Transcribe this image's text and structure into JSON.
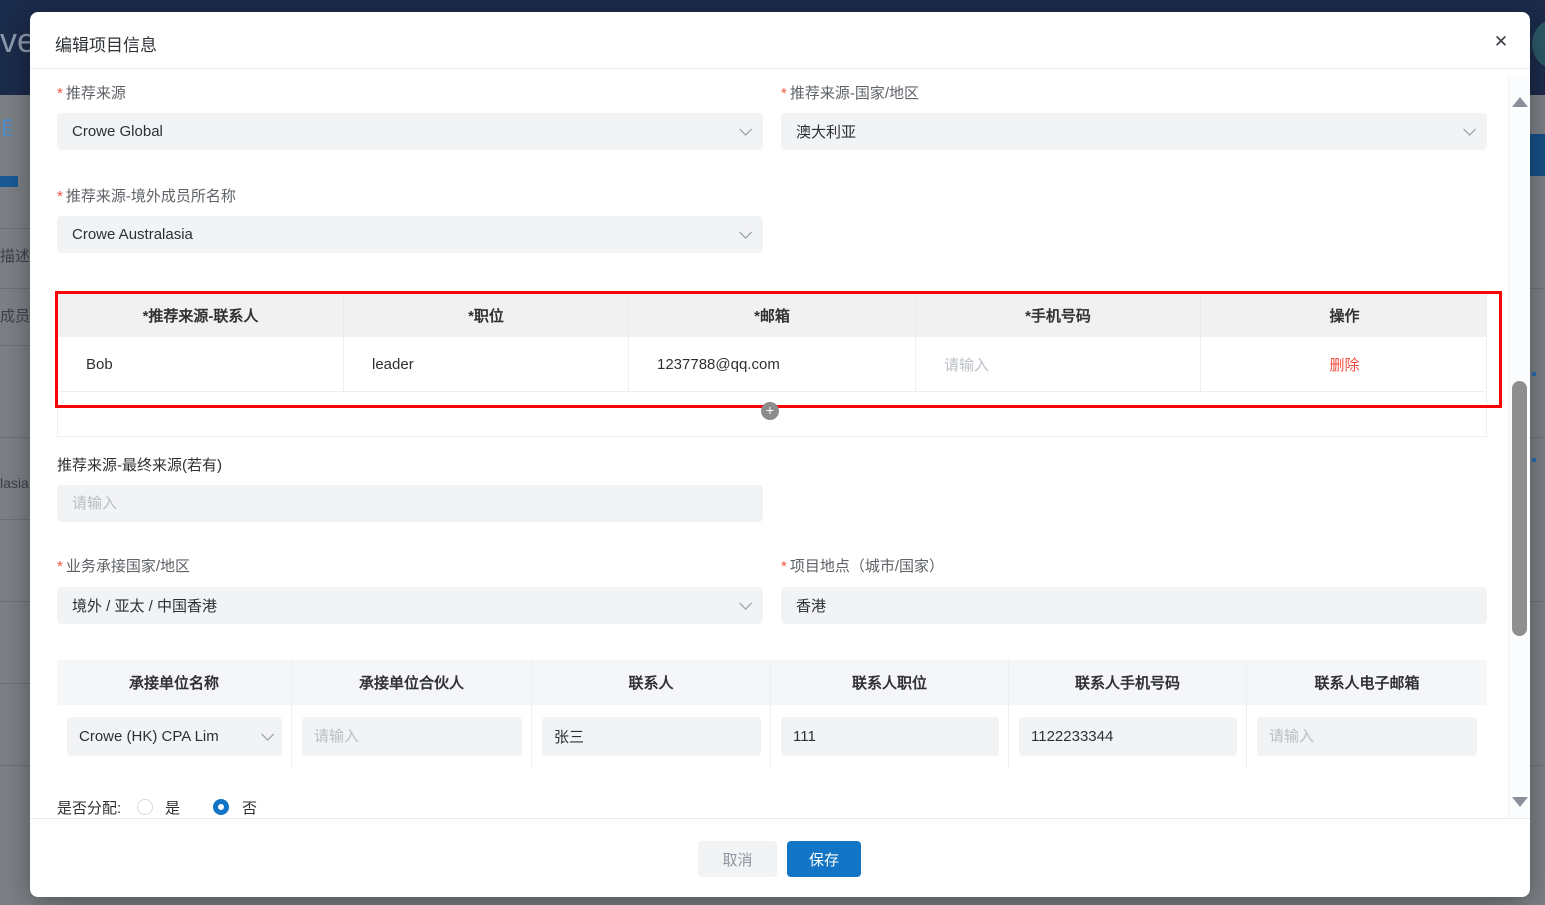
{
  "required_marker": "*",
  "colors": {
    "accent_blue": "#1274c4",
    "delete_red": "#f44c3f",
    "annotation_red": "#fc0204",
    "navy": "#1b2b4b"
  },
  "backdrop": {
    "logo_fragment": "ve",
    "left_fragments": {
      "describe": "描述",
      "member": "成员",
      "lasia": "lasia"
    }
  },
  "modal": {
    "title": "编辑项目信息",
    "close_icon": "✕",
    "fields": {
      "referral_source": {
        "label": "推荐来源",
        "value": "Crowe Global"
      },
      "referral_country": {
        "label": "推荐来源-国家/地区",
        "value": "澳大利亚"
      },
      "referral_firm": {
        "label": "推荐来源-境外成员所名称",
        "value": "Crowe Australasia"
      },
      "final_source": {
        "label": "推荐来源-最终来源(若有)",
        "placeholder": "请输入"
      },
      "business_country": {
        "label": "业务承接国家/地区",
        "value": "境外 / 亚太 / 中国香港"
      },
      "project_location": {
        "label": "项目地点（城市/国家）",
        "value": "香港"
      }
    },
    "contacts_table": {
      "headers": [
        "*推荐来源-联系人",
        "*职位",
        "*邮箱",
        "*手机号码",
        "操作"
      ],
      "row": {
        "contact": "Bob",
        "position": "leader",
        "email": "1237788@qq.com",
        "phone_placeholder": "请输入",
        "action": "删除"
      },
      "add_icon": "+"
    },
    "undertaking_table": {
      "headers": [
        "承接单位名称",
        "承接单位合伙人",
        "联系人",
        "联系人职位",
        "联系人手机号码",
        "联系人电子邮箱"
      ],
      "row": {
        "unit_name": "Crowe (HK) CPA Lim",
        "partner_placeholder": "请输入",
        "contact": "张三",
        "position": "111",
        "phone": "1122233344",
        "email_placeholder": "请输入"
      }
    },
    "allocation": {
      "label": "是否分配:",
      "options": [
        {
          "label": "是",
          "selected": false
        },
        {
          "label": "否",
          "selected": true
        }
      ]
    },
    "footer": {
      "cancel": "取消",
      "save": "保存"
    }
  }
}
